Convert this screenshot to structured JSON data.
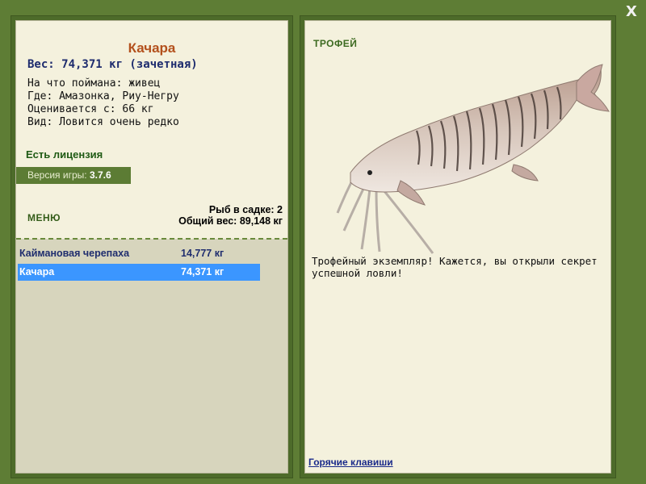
{
  "close_button": "X",
  "fish_card": {
    "name": "Качара",
    "weight_line": "Вес: 74,371 кг (зачетная)",
    "caught_on": "На что поймана: живец",
    "location": "Где: Амазонка, Риу-Негру",
    "rated_from": "Оценивается с: 66 кг",
    "rarity": "Вид: Ловится очень редко"
  },
  "license": "Есть лицензия",
  "version": {
    "label": "Версия игры:",
    "value": "3.7.6"
  },
  "menu_label": "МЕНЮ",
  "cage": {
    "count_line": "Рыб в садке: 2",
    "total_line": "Общий вес: 89,148 кг"
  },
  "fish_list": [
    {
      "name": "Каймановая черепаха",
      "weight": "14,777 кг",
      "selected": false
    },
    {
      "name": "Качара",
      "weight": "74,371 кг",
      "selected": true
    }
  ],
  "trophy": {
    "title": "ТРОФЕЙ",
    "text": "Трофейный экземпляр! Кажется, вы открыли секрет успешной ловли!"
  },
  "hotkeys_label": "Горячие клавиши",
  "colors": {
    "background": "#5e7d35",
    "panel": "#f4f1dd",
    "selected_row": "#3b96ff",
    "fish_name": "#b3501c"
  }
}
